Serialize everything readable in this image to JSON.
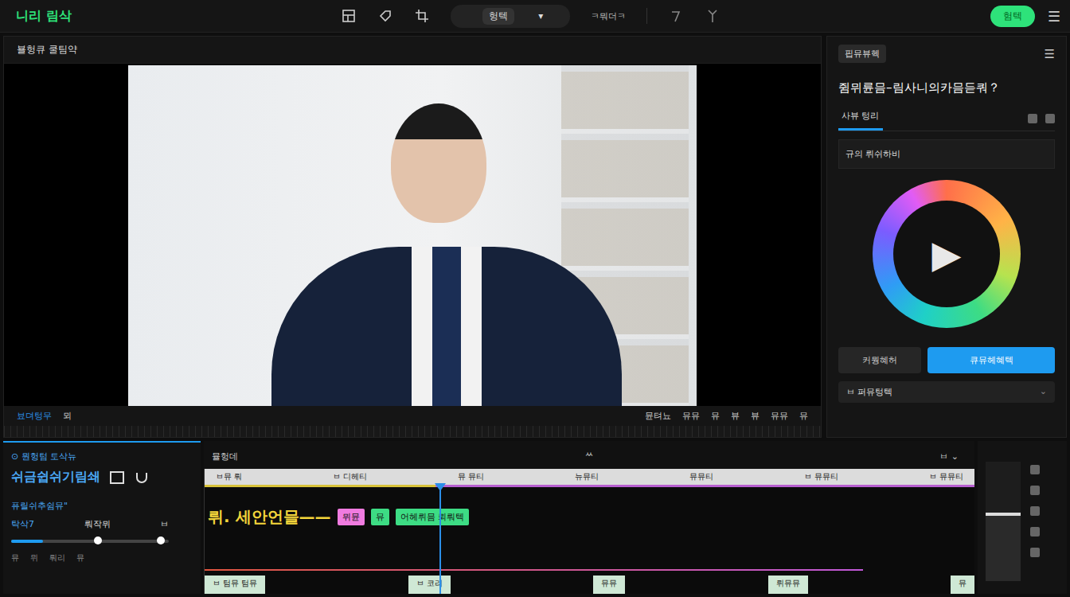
{
  "window": {
    "logo": "니리 림삭",
    "mode_dropdown": {
      "label": "헝텍",
      "arrow": "▾"
    },
    "status": "ㅋ뭐더ㅋ",
    "export_button": "험텍",
    "menu": "☰"
  },
  "preview": {
    "title": "뵬헝큐 쿨팀약",
    "toolbar_left": [
      "뵤뎌텅무",
      "뫼"
    ],
    "toolbar_right": [
      "뮨텨뇨",
      "뮤뮤",
      "뮤",
      "뷰",
      "뷰",
      "뮤뮤",
      "뮤"
    ]
  },
  "inspector": {
    "chip": "핍뮤뷰헥",
    "menu": "☰",
    "title": "쥠뮈륜믐–림사니의카믐듣쿼？",
    "tabs": [
      {
        "label": "사뷰 텅리",
        "selected": true
      }
    ],
    "field": "규의 뤼쉬하비",
    "play": "▶",
    "buttons": [
      {
        "label": "커뭥혜허",
        "primary": false
      },
      {
        "label": "큐뮤헤혜텍",
        "primary": true
      }
    ],
    "dropdown": {
      "label": "ㅂ 퍼뮤텅텍",
      "arrow": "⌄"
    }
  },
  "timeline_panel": {
    "title": "⊙ 뭔헝텀 토삭뉴",
    "subtitle": "쉬금쉽쉬기림쇄",
    "label": "퓨릴쉬추쉼뮤\"",
    "controls": [
      "탁삭7",
      "뤄작뮈",
      "ㅂ"
    ],
    "slider": {
      "level": 0.2,
      "handles": [
        0.55,
        0.95
      ]
    },
    "footer": [
      "뮤",
      "뮈",
      "뤄리",
      "뮤"
    ]
  },
  "timeline": {
    "title": "뮬헝데",
    "center_mark": "ᄊ",
    "corner": "ㅂ ⌄",
    "ruler": [
      "ㅂ뮤 뤄",
      "ㅂ 디헤티",
      "뮤 뮤티",
      "뉴뮤티",
      "뮤뮤티",
      "ㅂ 뮤뮤티",
      "ㅂ 뮤뮤티"
    ],
    "caption": "뤼. 세안언믈——",
    "tags": [
      {
        "label": "뮈뮨",
        "color": "#f07be0"
      },
      {
        "label": "뮤",
        "color": "#3ddc84"
      },
      {
        "label": "어헤뤼믐 뢰뤄텍",
        "color": "#3ddc84"
      }
    ],
    "playhead": {
      "level": 0.305
    },
    "clips": [
      "ㅂ 텀뮤 텀뮤",
      "ㅂ 코리",
      "뮤뮤",
      "뤼뮤뮤",
      "뮤"
    ]
  },
  "side_meter": {
    "level": 0.55
  }
}
